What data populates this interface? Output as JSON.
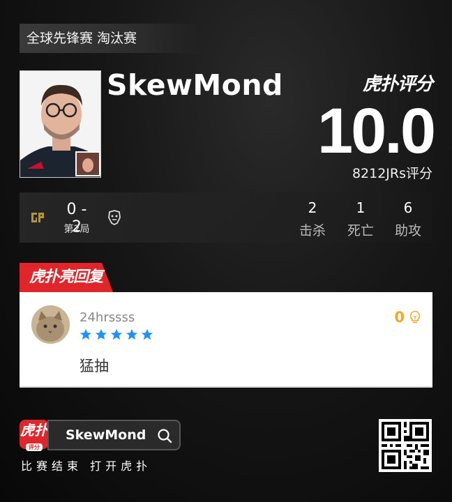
{
  "match": {
    "tournament_stage": "全球先锋赛 淘汰赛"
  },
  "player": {
    "name": "SkewMond"
  },
  "rating": {
    "brand": "虎扑评分",
    "score": "10.0",
    "count_text": "8212JRs评分"
  },
  "series": {
    "score": "0 - 2",
    "game_label": "第2局",
    "left_team_icon": "gen-g-logo",
    "right_team_icon": "g2-logo"
  },
  "stats": [
    {
      "value": "2",
      "label": "击杀"
    },
    {
      "value": "1",
      "label": "死亡"
    },
    {
      "value": "6",
      "label": "助攻"
    }
  ],
  "highlight_reply": {
    "tab_label": "虎扑亮回复",
    "username": "24hrssss",
    "stars": 5,
    "comment": "猛抽",
    "likes": "0",
    "star_color": "#1e90ff",
    "like_color": "#f5a623"
  },
  "footer": {
    "app_icon_main": "虎扑",
    "app_icon_sub": "评分",
    "search_query": "SkewMond",
    "cta": "比赛结束 打开虎扑"
  },
  "colors": {
    "accent_red": "#e0262b",
    "background": "#121212"
  }
}
